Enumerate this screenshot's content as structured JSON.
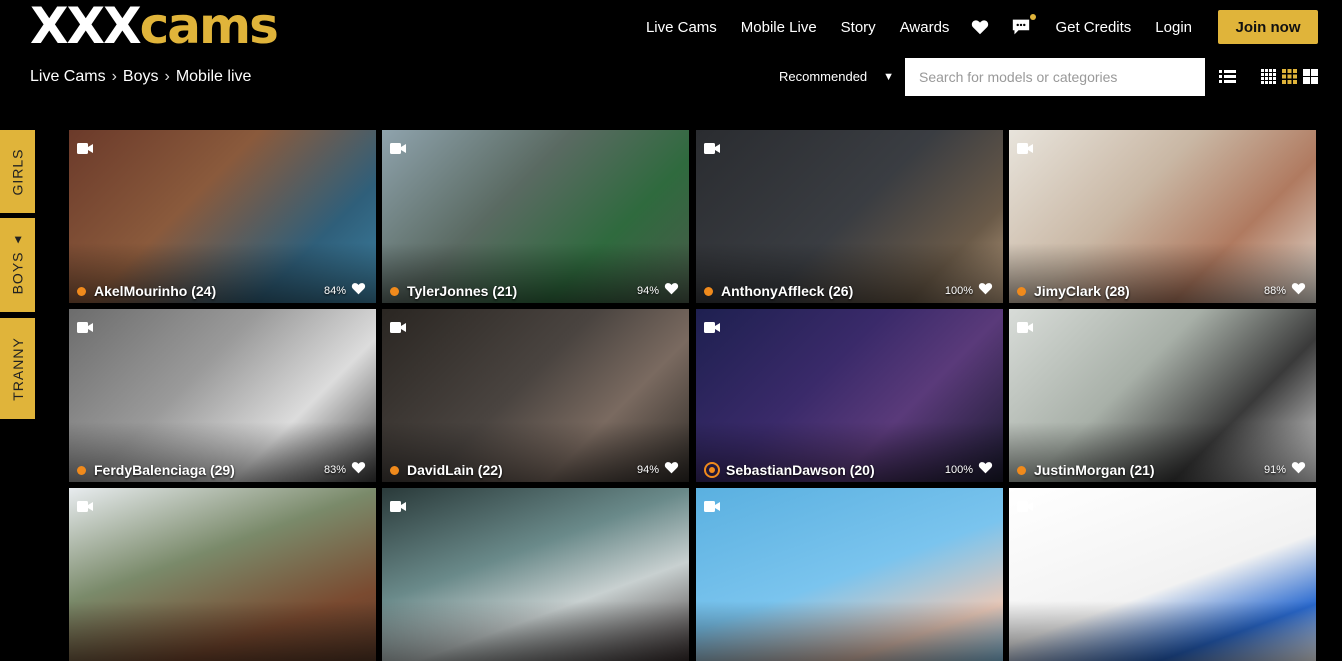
{
  "brand": {
    "logo_part1": "XXX",
    "logo_part2": "cams"
  },
  "nav": {
    "live_cams": "Live Cams",
    "mobile_live": "Mobile Live",
    "story": "Story",
    "awards": "Awards",
    "favorites_icon": "heart-icon",
    "messages_icon": "chat-icon",
    "get_credits": "Get Credits",
    "login": "Login",
    "join": "Join now"
  },
  "breadcrumb": {
    "items": [
      "Live Cams",
      "Boys",
      "Mobile live"
    ]
  },
  "sort": {
    "selected": "Recommended"
  },
  "search": {
    "placeholder": "Search for models or categories"
  },
  "view_options": [
    "list-view-icon",
    "small-grid-icon",
    "medium-grid-icon",
    "large-grid-icon"
  ],
  "side_tabs": [
    {
      "label": "GIRLS"
    },
    {
      "label": "BOYS",
      "active": true
    },
    {
      "label": "TRANNY"
    }
  ],
  "colors": {
    "accent": "#e0b43a",
    "status": "#f08a1c",
    "background": "#000000"
  },
  "models": [
    {
      "name": "AkelMourinho (24)",
      "rating": "84%"
    },
    {
      "name": "TylerJonnes (21)",
      "rating": "94%"
    },
    {
      "name": "AnthonyAffleck (26)",
      "rating": "100%"
    },
    {
      "name": "JimyClark (28)",
      "rating": "88%"
    },
    {
      "name": "FerdyBalenciaga (29)",
      "rating": "83%"
    },
    {
      "name": "DavidLain (22)",
      "rating": "94%"
    },
    {
      "name": "SebastianDawson (20)",
      "rating": "100%"
    },
    {
      "name": "JustinMorgan (21)",
      "rating": "91%"
    },
    {
      "name": "",
      "rating": ""
    },
    {
      "name": "",
      "rating": ""
    },
    {
      "name": "",
      "rating": ""
    },
    {
      "name": "",
      "rating": ""
    }
  ]
}
